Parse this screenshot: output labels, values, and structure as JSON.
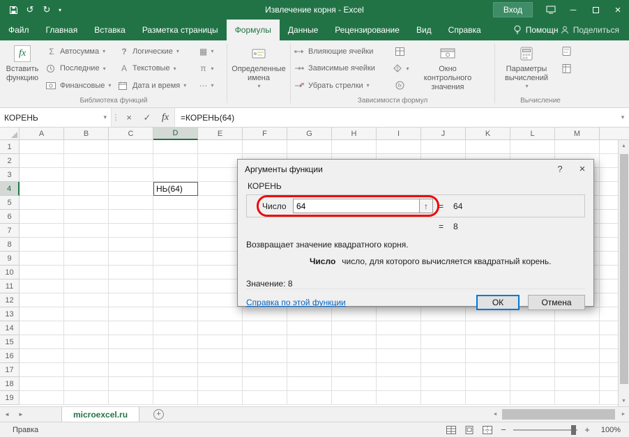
{
  "titlebar": {
    "title": "Извлечение корня - Excel",
    "signin": "Вход"
  },
  "menu": {
    "tabs": [
      "Файл",
      "Главная",
      "Вставка",
      "Разметка страницы",
      "Формулы",
      "Данные",
      "Рецензирование",
      "Вид",
      "Справка"
    ],
    "active_tab": "Формулы",
    "assistant": "Помощн",
    "share": "Поделиться"
  },
  "ribbon": {
    "insert_function": "Вставить функцию",
    "autosum": "Автосумма",
    "recent": "Последние",
    "financial": "Финансовые",
    "logical": "Логические",
    "text_functions": "Текстовые",
    "datetime": "Дата и время",
    "defined_names": "Определенные имена",
    "trace_precedents": "Влияющие ячейки",
    "trace_dependents": "Зависимые ячейки",
    "remove_arrows": "Убрать стрелки",
    "watch_window": "Окно контрольного значения",
    "calc_options": "Параметры вычислений",
    "labels": {
      "library": "Библиотека функций",
      "dependencies": "Зависимости формул",
      "calculation": "Вычисление"
    }
  },
  "formula_bar": {
    "name_box": "КОРЕНЬ",
    "formula": "=КОРЕНЬ(64)"
  },
  "grid": {
    "columns": [
      "A",
      "B",
      "C",
      "D",
      "E",
      "F",
      "G",
      "H",
      "I",
      "J",
      "K",
      "L",
      "M"
    ],
    "row_count": 19,
    "active_cell": {
      "col": "D",
      "row": 4,
      "text": "НЬ(64)"
    }
  },
  "dialog": {
    "title": "Аргументы функции",
    "function_name": "КОРЕНЬ",
    "arg_label": "Число",
    "arg_value": "64",
    "equals": "=",
    "arg_result": "64",
    "result": "8",
    "description": "Возвращает значение квадратного корня.",
    "hint_term": "Число",
    "hint_text": "число, для которого вычисляется квадратный корень.",
    "value_line": "Значение: 8",
    "help_link": "Справка по этой функции",
    "ok": "ОК",
    "cancel": "Отмена"
  },
  "sheet_tabs": {
    "active": "microexcel.ru"
  },
  "status_bar": {
    "mode": "Правка",
    "zoom": "100%"
  },
  "icons": {
    "caret": "▾",
    "undo": "↺",
    "redo": "↻",
    "close": "×",
    "minimize": "─",
    "check": "✓",
    "x": "×",
    "fx": "fx",
    "sigma": "Σ",
    "question_mark": "?",
    "letter_a": "А",
    "pi": "π",
    "grid": "▦",
    "ellipsis": "⋯",
    "up_arrow": "↑",
    "help": "?",
    "left_pointer": "◄",
    "right_pointer": "►",
    "up_pointer": "▲",
    "down_pointer": "▼",
    "plus": "+",
    "minus": "−",
    "dots": "⋮"
  },
  "colors": {
    "excel_green": "#217346",
    "annotation_red": "#ec0a0a",
    "ok_border_blue": "#0078d7",
    "link_blue": "#0563c1"
  }
}
